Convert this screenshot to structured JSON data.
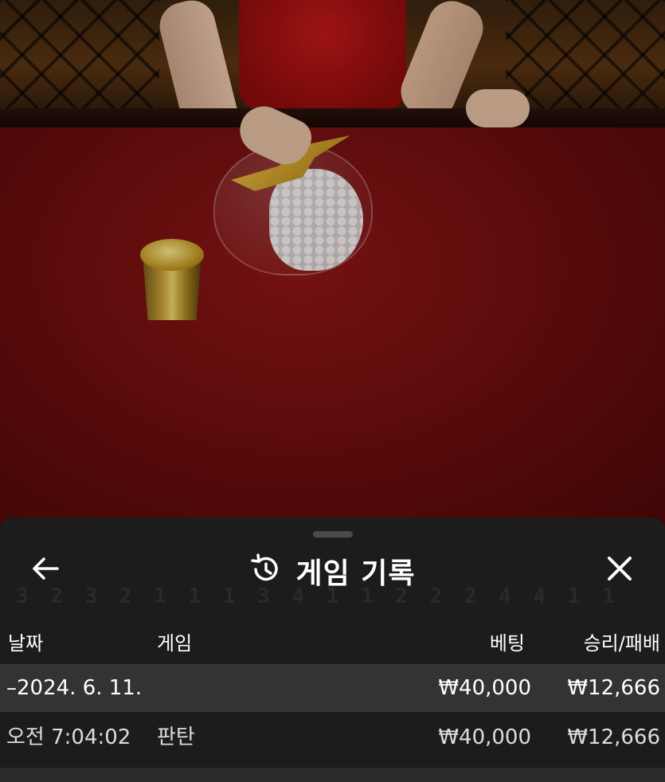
{
  "sheet": {
    "title": "게임 기록",
    "icons": {
      "back": "arrow-left-icon",
      "history": "history-icon",
      "close": "close-icon"
    },
    "ghost_numbers": "3 2 3 2 1 1 1 3 4 1 1 2 2 2 4 4 1 1",
    "columns": {
      "date": "날짜",
      "game": "게임",
      "bet": "베팅",
      "win_loss": "승리/패배"
    },
    "rows": [
      {
        "date": "–2024. 6. 11.",
        "game": "",
        "bet": "₩40,000",
        "win_loss": "₩12,666"
      },
      {
        "date": "오전 7:04:02",
        "game": "판탄",
        "bet": "₩40,000",
        "win_loss": "₩12,666"
      }
    ]
  },
  "colors": {
    "sheet_bg": "#1c1c1c",
    "summary_row_bg": "#333333",
    "felt": "#8e1616"
  }
}
